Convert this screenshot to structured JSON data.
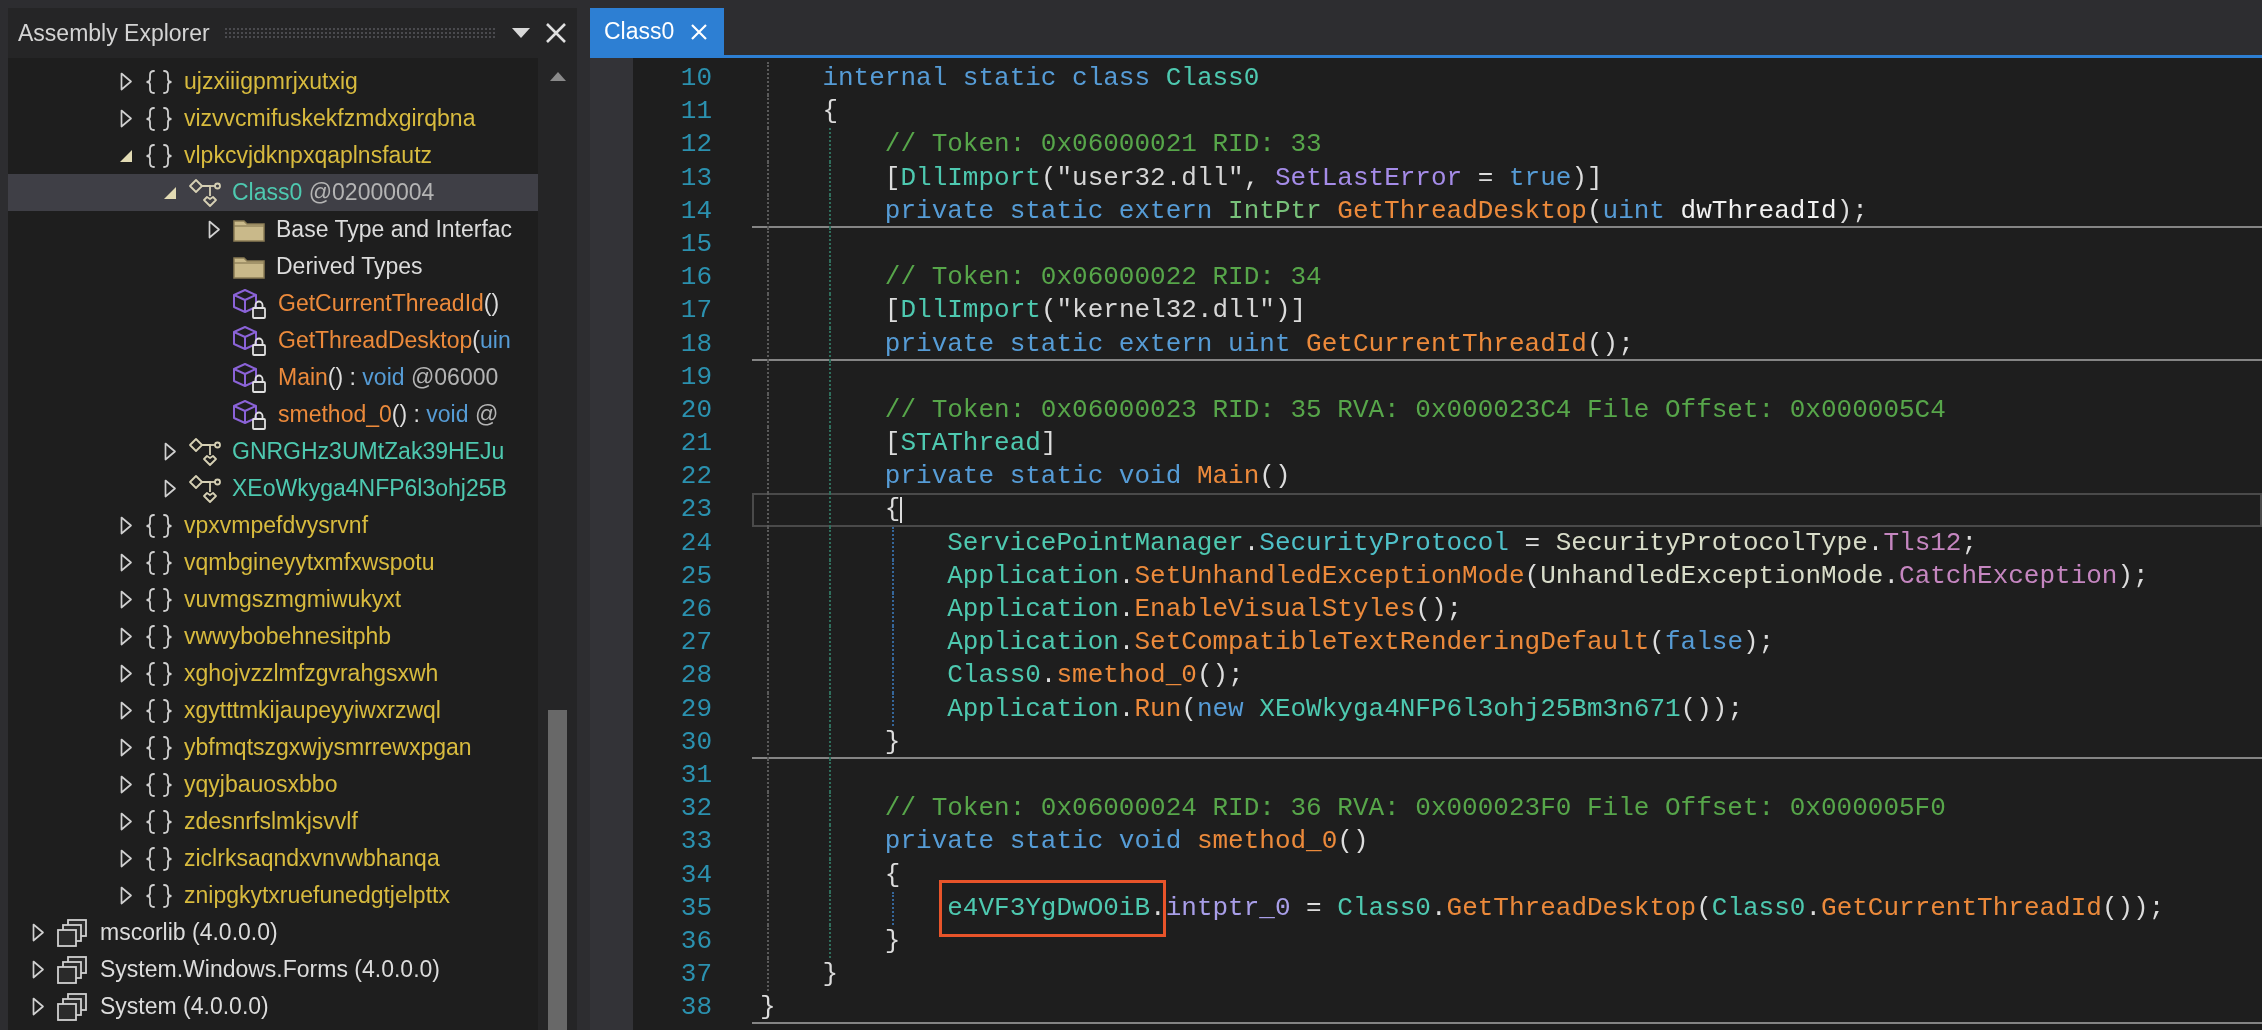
{
  "explorer": {
    "title": "Assembly Explorer",
    "tree": {
      "scrolled_branch": [
        {
          "kind": "namespace",
          "label": "ujzxiiigpmrjxutxig",
          "expanded": false,
          "selected": false
        },
        {
          "kind": "namespace",
          "label": "vizvvcmifuskekfzmdxgirqbna",
          "expanded": false,
          "selected": false
        },
        {
          "kind": "namespace",
          "label": "vlpkcvjdknpxqaplnsfautz",
          "expanded": true,
          "selected": false,
          "children": [
            {
              "kind": "class",
              "parts": [
                {
                  "text": "Class0",
                  "kind": "type"
                },
                {
                  "text": " @02000004",
                  "kind": "token"
                }
              ],
              "expanded": true,
              "selected": true,
              "children": [
                {
                  "kind": "folder",
                  "label": "Base Type and Interfac",
                  "expanded": false,
                  "selected": false
                },
                {
                  "kind": "folder",
                  "label": "Derived Types",
                  "selected": false
                },
                {
                  "kind": "method",
                  "parts": [
                    {
                      "text": "GetCurrentThreadId",
                      "kind": "method"
                    },
                    {
                      "text": "()",
                      "kind": "punct"
                    }
                  ],
                  "selected": false
                },
                {
                  "kind": "method",
                  "parts": [
                    {
                      "text": "GetThreadDesktop",
                      "kind": "method"
                    },
                    {
                      "text": "(",
                      "kind": "punct"
                    },
                    {
                      "text": "uin",
                      "kind": "keyword"
                    }
                  ],
                  "selected": false
                },
                {
                  "kind": "method",
                  "parts": [
                    {
                      "text": "Main",
                      "kind": "method"
                    },
                    {
                      "text": "() : ",
                      "kind": "punct"
                    },
                    {
                      "text": "void",
                      "kind": "keyword"
                    },
                    {
                      "text": " @06000",
                      "kind": "token"
                    }
                  ],
                  "selected": false
                },
                {
                  "kind": "method",
                  "parts": [
                    {
                      "text": "smethod_0",
                      "kind": "method"
                    },
                    {
                      "text": "() : ",
                      "kind": "punct"
                    },
                    {
                      "text": "void",
                      "kind": "keyword"
                    },
                    {
                      "text": " @",
                      "kind": "token"
                    }
                  ],
                  "selected": false
                }
              ]
            },
            {
              "kind": "class",
              "label": "GNRGHz3UMtZak39HEJu",
              "expanded": false,
              "selected": false
            },
            {
              "kind": "class",
              "label": "XEoWkyga4NFP6l3ohj25B",
              "expanded": false,
              "selected": false
            }
          ]
        },
        {
          "kind": "namespace",
          "label": "vpxvmpefdvysrvnf",
          "expanded": false,
          "selected": false
        },
        {
          "kind": "namespace",
          "label": "vqmbgineyytxmfxwspotu",
          "expanded": false,
          "selected": false
        },
        {
          "kind": "namespace",
          "label": "vuvmgszmgmiwukyxt",
          "expanded": false,
          "selected": false
        },
        {
          "kind": "namespace",
          "label": "vwwybobehnesitphb",
          "expanded": false,
          "selected": false
        },
        {
          "kind": "namespace",
          "label": "xghojvzzlmfzgvrahgsxwh",
          "expanded": false,
          "selected": false
        },
        {
          "kind": "namespace",
          "label": "xgytttmkijaupeyyiwxrzwql",
          "expanded": false,
          "selected": false
        },
        {
          "kind": "namespace",
          "label": "ybfmqtszgxwjysmrrewxpgan",
          "expanded": false,
          "selected": false
        },
        {
          "kind": "namespace",
          "label": "yqyjbauosxbbo",
          "expanded": false,
          "selected": false
        },
        {
          "kind": "namespace",
          "label": "zdesnrfslmkjsvvlf",
          "expanded": false,
          "selected": false
        },
        {
          "kind": "namespace",
          "label": "ziclrksaqndxvnvwbhanqa",
          "expanded": false,
          "selected": false
        },
        {
          "kind": "namespace",
          "label": "znipgkytxruefunedgtjelpttx",
          "expanded": false,
          "selected": false
        }
      ],
      "items": [
        {
          "kind": "assembly",
          "label": "mscorlib (4.0.0.0)",
          "expanded": false,
          "selected": false
        },
        {
          "kind": "assembly",
          "label": "System.Windows.Forms (4.0.0.0)",
          "expanded": false,
          "selected": false
        },
        {
          "kind": "assembly",
          "label": "System (4.0.0.0)",
          "expanded": false,
          "selected": false
        }
      ]
    }
  },
  "editor": {
    "tabs": [
      {
        "label": "Class0",
        "selected": true
      }
    ],
    "lines": [
      {
        "number": "10",
        "current": false,
        "separator": false,
        "parts": [
          {
            "text": "    internal static class ",
            "kind": "keyword"
          },
          {
            "text": "Class0",
            "kind": "type"
          }
        ]
      },
      {
        "number": "11",
        "current": false,
        "separator": false,
        "parts": [
          {
            "text": "    {",
            "kind": "punct"
          }
        ]
      },
      {
        "number": "12",
        "current": false,
        "separator": false,
        "parts": [
          {
            "text": "        // Token: 0x06000021 RID: 33",
            "kind": "comment"
          }
        ]
      },
      {
        "number": "13",
        "current": false,
        "separator": false,
        "parts": [
          {
            "text": "        [",
            "kind": "punct"
          },
          {
            "text": "DllImport",
            "kind": "type"
          },
          {
            "text": "(",
            "kind": "punct"
          },
          {
            "text": "\"user32.dll\"",
            "kind": "string"
          },
          {
            "text": ", ",
            "kind": "punct"
          },
          {
            "text": "SetLastError",
            "kind": "property"
          },
          {
            "text": " = ",
            "kind": "punct"
          },
          {
            "text": "true",
            "kind": "keyword"
          },
          {
            "text": ")]",
            "kind": "punct"
          }
        ]
      },
      {
        "number": "14",
        "current": false,
        "separator": true,
        "parts": [
          {
            "text": "        private static extern ",
            "kind": "keyword"
          },
          {
            "text": "IntPtr",
            "kind": "struct"
          },
          {
            "text": " GetThreadDesktop",
            "kind": "method"
          },
          {
            "text": "(",
            "kind": "punct"
          },
          {
            "text": "uint",
            "kind": "keyword"
          },
          {
            "text": " dwThreadId",
            "kind": "parameter"
          },
          {
            "text": ");",
            "kind": "punct"
          }
        ]
      },
      {
        "number": "15",
        "current": false,
        "separator": false
      },
      {
        "number": "16",
        "current": false,
        "separator": false,
        "parts": [
          {
            "text": "        // Token: 0x06000022 RID: 34",
            "kind": "comment"
          }
        ]
      },
      {
        "number": "17",
        "current": false,
        "separator": false,
        "parts": [
          {
            "text": "        [",
            "kind": "punct"
          },
          {
            "text": "DllImport",
            "kind": "type"
          },
          {
            "text": "(",
            "kind": "punct"
          },
          {
            "text": "\"kernel32.dll\"",
            "kind": "string"
          },
          {
            "text": ")]",
            "kind": "punct"
          }
        ]
      },
      {
        "number": "18",
        "current": false,
        "separator": true,
        "parts": [
          {
            "text": "        private static extern uint ",
            "kind": "keyword"
          },
          {
            "text": "GetCurrentThreadId",
            "kind": "method"
          },
          {
            "text": "();",
            "kind": "punct"
          }
        ]
      },
      {
        "number": "19",
        "current": false,
        "separator": false
      },
      {
        "number": "20",
        "current": false,
        "separator": false,
        "parts": [
          {
            "text": "        // Token: 0x06000023 RID: 35 RVA: 0x000023C4 File Offset: 0x000005C4",
            "kind": "comment"
          }
        ]
      },
      {
        "number": "21",
        "current": false,
        "separator": false,
        "parts": [
          {
            "text": "        [",
            "kind": "punct"
          },
          {
            "text": "STAThread",
            "kind": "type"
          },
          {
            "text": "]",
            "kind": "punct"
          }
        ]
      },
      {
        "number": "22",
        "current": false,
        "separator": false,
        "parts": [
          {
            "text": "        private static void ",
            "kind": "keyword"
          },
          {
            "text": "Main",
            "kind": "method"
          },
          {
            "text": "()",
            "kind": "punct"
          }
        ]
      },
      {
        "number": "23",
        "current": true,
        "separator": false,
        "parts": [
          {
            "text": "        {",
            "kind": "punct"
          }
        ]
      },
      {
        "number": "24",
        "current": false,
        "separator": false,
        "parts": [
          {
            "text": "            ServicePointManager",
            "kind": "type"
          },
          {
            "text": ".",
            "kind": "punct"
          },
          {
            "text": "SecurityProtocol",
            "kind": "static_property"
          },
          {
            "text": " = ",
            "kind": "punct"
          },
          {
            "text": "SecurityProtocolType",
            "kind": "enum"
          },
          {
            "text": ".",
            "kind": "punct"
          },
          {
            "text": "Tls12",
            "kind": "enum_field"
          },
          {
            "text": ";",
            "kind": "punct"
          }
        ]
      },
      {
        "number": "25",
        "current": false,
        "separator": false,
        "parts": [
          {
            "text": "            Application",
            "kind": "type"
          },
          {
            "text": ".",
            "kind": "punct"
          },
          {
            "text": "SetUnhandledExceptionMode",
            "kind": "method"
          },
          {
            "text": "(",
            "kind": "punct"
          },
          {
            "text": "UnhandledExceptionMode",
            "kind": "enum"
          },
          {
            "text": ".",
            "kind": "punct"
          },
          {
            "text": "CatchException",
            "kind": "enum_field"
          },
          {
            "text": ");",
            "kind": "punct"
          }
        ]
      },
      {
        "number": "26",
        "current": false,
        "separator": false,
        "parts": [
          {
            "text": "            Application",
            "kind": "type"
          },
          {
            "text": ".",
            "kind": "punct"
          },
          {
            "text": "EnableVisualStyles",
            "kind": "method"
          },
          {
            "text": "();",
            "kind": "punct"
          }
        ]
      },
      {
        "number": "27",
        "current": false,
        "separator": false,
        "parts": [
          {
            "text": "            Application",
            "kind": "type"
          },
          {
            "text": ".",
            "kind": "punct"
          },
          {
            "text": "SetCompatibleTextRenderingDefault",
            "kind": "method"
          },
          {
            "text": "(",
            "kind": "punct"
          },
          {
            "text": "false",
            "kind": "keyword"
          },
          {
            "text": ");",
            "kind": "punct"
          }
        ]
      },
      {
        "number": "28",
        "current": false,
        "separator": false,
        "parts": [
          {
            "text": "            Class0",
            "kind": "type"
          },
          {
            "text": ".",
            "kind": "punct"
          },
          {
            "text": "smethod_0",
            "kind": "method"
          },
          {
            "text": "();",
            "kind": "punct"
          }
        ]
      },
      {
        "number": "29",
        "current": false,
        "separator": false,
        "parts": [
          {
            "text": "            Application",
            "kind": "type"
          },
          {
            "text": ".",
            "kind": "punct"
          },
          {
            "text": "Run",
            "kind": "method"
          },
          {
            "text": "(",
            "kind": "punct"
          },
          {
            "text": "new ",
            "kind": "keyword"
          },
          {
            "text": "XEoWkyga4NFP6l3ohj25Bm3n671",
            "kind": "type"
          },
          {
            "text": "());",
            "kind": "punct"
          }
        ]
      },
      {
        "number": "30",
        "current": false,
        "separator": true,
        "parts": [
          {
            "text": "        }",
            "kind": "punct"
          }
        ]
      },
      {
        "number": "31",
        "current": false,
        "separator": false
      },
      {
        "number": "32",
        "current": false,
        "separator": false,
        "parts": [
          {
            "text": "        // Token: 0x06000024 RID: 36 RVA: 0x000023F0 File Offset: 0x000005F0",
            "kind": "comment"
          }
        ]
      },
      {
        "number": "33",
        "current": false,
        "separator": false,
        "parts": [
          {
            "text": "        private static void ",
            "kind": "keyword"
          },
          {
            "text": "smethod_0",
            "kind": "method"
          },
          {
            "text": "()",
            "kind": "punct"
          }
        ]
      },
      {
        "number": "34",
        "current": false,
        "separator": false,
        "parts": [
          {
            "text": "        {",
            "kind": "punct"
          }
        ]
      },
      {
        "number": "35",
        "current": false,
        "separator": false,
        "parts": [
          {
            "text": "            e4VF3YgDwO0iB",
            "kind": "type",
            "boxed": true
          },
          {
            "text": ".",
            "kind": "punct"
          },
          {
            "text": "intptr_0",
            "kind": "field"
          },
          {
            "text": " = ",
            "kind": "punct"
          },
          {
            "text": "Class0",
            "kind": "type"
          },
          {
            "text": ".",
            "kind": "punct"
          },
          {
            "text": "GetThreadDesktop",
            "kind": "method"
          },
          {
            "text": "(",
            "kind": "punct"
          },
          {
            "text": "Class0",
            "kind": "type"
          },
          {
            "text": ".",
            "kind": "punct"
          },
          {
            "text": "GetCurrentThreadId",
            "kind": "method"
          },
          {
            "text": "());",
            "kind": "punct"
          }
        ]
      },
      {
        "number": "36",
        "current": false,
        "separator": false,
        "parts": [
          {
            "text": "        }",
            "kind": "punct"
          }
        ]
      },
      {
        "number": "37",
        "current": false,
        "separator": false,
        "parts": [
          {
            "text": "    }",
            "kind": "punct"
          }
        ]
      },
      {
        "number": "38",
        "current": false,
        "separator": true,
        "parts": [
          {
            "text": "}",
            "kind": "punct"
          }
        ]
      }
    ]
  }
}
